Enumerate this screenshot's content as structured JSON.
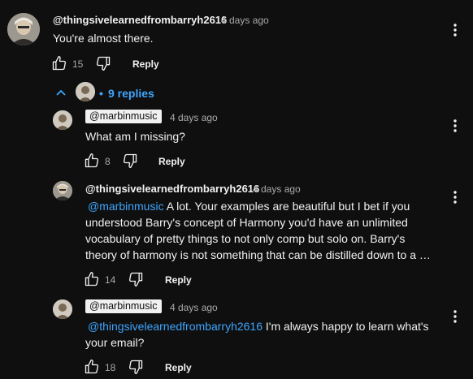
{
  "comment": {
    "author": "@thingsivelearnedfrombarryh2616",
    "time": "4 days ago",
    "text": "You're almost there.",
    "likes": "15",
    "reply_label": "Reply"
  },
  "replies_toggle": {
    "label": "9 replies",
    "bullet": "•"
  },
  "replies": [
    {
      "author": "@marbinmusic",
      "time": "4 days ago",
      "text": "What am I missing?",
      "likes": "8",
      "reply_label": "Reply"
    },
    {
      "author": "@thingsivelearnedfrombarryh2616",
      "time": "4 days ago",
      "mention": "@marbinmusic",
      "text_l1": " A lot. Your examples are beautiful but I bet if you",
      "text_l2": "understood Barry's concept of Harmony you'd have an unlimited",
      "text_l3": "vocabulary of pretty things to not only comp but solo on. Barry's",
      "text_l4": "theory of harmony is not something that can be distilled down to a …",
      "likes": "14",
      "reply_label": "Reply"
    },
    {
      "author": "@marbinmusic",
      "time": "4 days ago",
      "mention": "@thingsivelearnedfrombarryh2616",
      "text_l1": " I'm always happy to learn what's",
      "text_l2": "your email?",
      "likes": "18",
      "reply_label": "Reply"
    }
  ],
  "colors": {
    "background": "#0f0f0f",
    "text": "#f1f1f1",
    "secondary": "#aaaaaa",
    "link": "#3ea6ff"
  },
  "icons": [
    "thumbs-up-icon",
    "thumbs-down-icon",
    "more-vert-icon",
    "chevron-up-icon"
  ]
}
